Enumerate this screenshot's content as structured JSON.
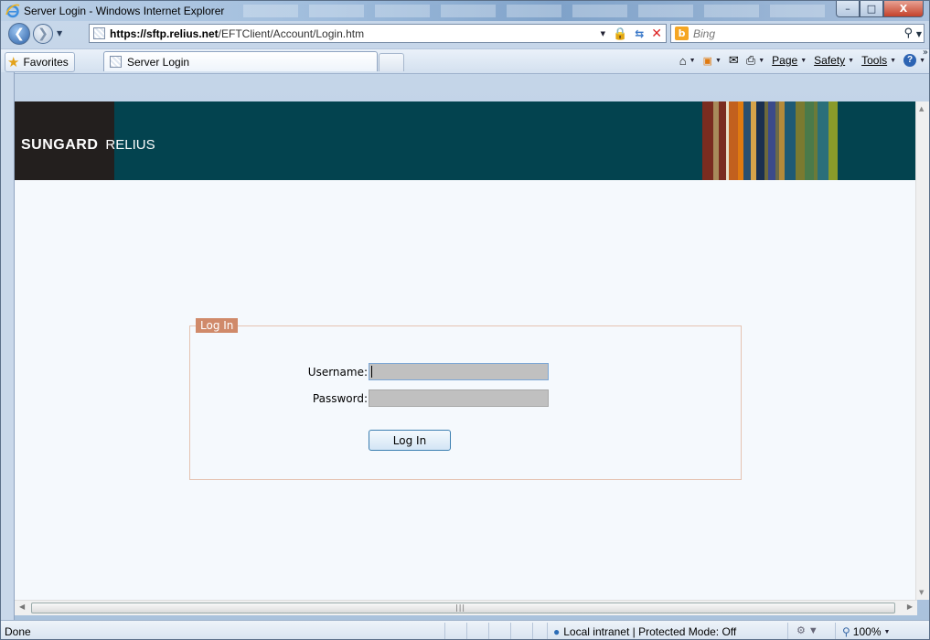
{
  "window": {
    "title": "Server Login - Windows Internet Explorer",
    "minimize": "–",
    "maximize": "□",
    "close": "X"
  },
  "address_bar": {
    "url_host": "https://sftp.relius.net",
    "url_path": "/EFTClient/Account/Login.htm",
    "search_placeholder": "Bing",
    "bing_glyph": "b"
  },
  "favorites_bar": {
    "favorites_label": "Favorites",
    "tab_label": "Server Login"
  },
  "command_bar": {
    "page": "Page",
    "safety": "Safety",
    "tools": "Tools",
    "help": "?"
  },
  "banner": {
    "brand": "SUNGARD",
    "product": "RELIUS",
    "stripe_colors": [
      "#7a2c20",
      "#a88b5b",
      "#7a2c20",
      "#e8e0c8",
      "#c2601e",
      "#e07a10",
      "#2a4f6f",
      "#d7a34a",
      "#1b3050",
      "#6f6a3a",
      "#3b4a8a",
      "#6b6a48",
      "#b48a3a",
      "#1e5a74",
      "#7a7a30",
      "#4a7a4a",
      "#6b7a38",
      "#2a6f7a",
      "#8a9b2a"
    ]
  },
  "login": {
    "legend": "Log In",
    "username_label": "Username:",
    "password_label": "Password:",
    "username_value": "",
    "password_value": "",
    "submit_label": "Log In"
  },
  "status_bar": {
    "status": "Done",
    "zone": "Local intranet | Protected Mode: Off",
    "zoom": "100%"
  }
}
